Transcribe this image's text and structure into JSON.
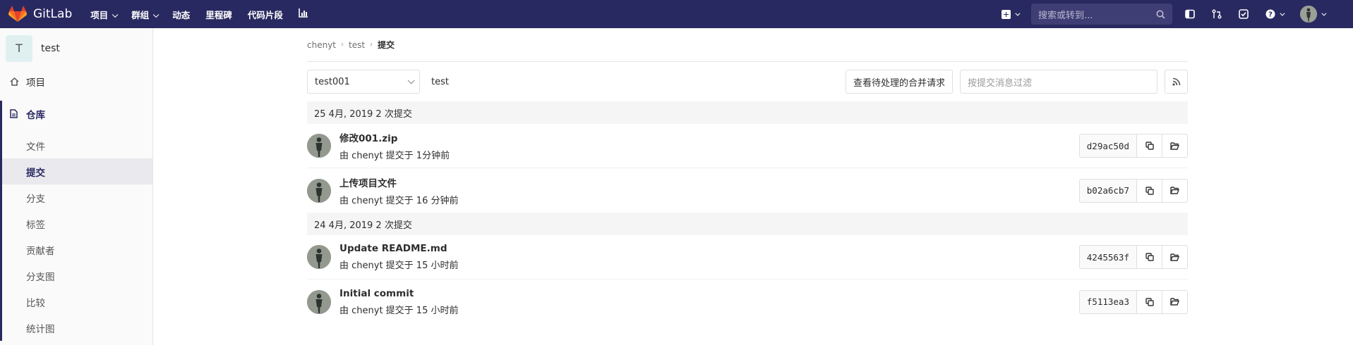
{
  "nav": {
    "brand": "GitLab",
    "items": [
      {
        "label": "项目",
        "caret": true
      },
      {
        "label": "群组",
        "caret": true
      },
      {
        "label": "动态",
        "caret": false
      },
      {
        "label": "里程碑",
        "caret": false
      },
      {
        "label": "代码片段",
        "caret": false
      }
    ],
    "search_placeholder": "搜索或转到..."
  },
  "sidebar": {
    "project_initial": "T",
    "project_name": "test",
    "project_item": "项目",
    "repo_item": "仓库",
    "sub_items": [
      "文件",
      "提交",
      "分支",
      "标签",
      "贡献者",
      "分支图",
      "比较",
      "统计图"
    ],
    "active_index": 1
  },
  "breadcrumb": {
    "parts": [
      "chenyt",
      "test"
    ],
    "current": "提交"
  },
  "controls": {
    "branch": "test001",
    "path": "test",
    "mr_button": "查看待处理的合并请求",
    "filter_placeholder": "按提交消息过滤"
  },
  "commit_groups": [
    {
      "header": "25 4月, 2019 2 次提交",
      "commits": [
        {
          "title": "修改001.zip",
          "meta": "由 chenyt 提交于 1分钟前",
          "sha": "d29ac50d"
        },
        {
          "title": "上传项目文件",
          "meta": "由 chenyt 提交于 16 分钟前",
          "sha": "b02a6cb7"
        }
      ]
    },
    {
      "header": "24 4月, 2019 2 次提交",
      "commits": [
        {
          "title": "Update README.md",
          "meta": "由 chenyt 提交于 15 小时前",
          "sha": "4245563f"
        },
        {
          "title": "Initial commit",
          "meta": "由 chenyt 提交于 15 小时前",
          "sha": "f5113ea3"
        }
      ]
    }
  ],
  "colors": {
    "nav_bg": "#292961",
    "accent": "#292961"
  }
}
